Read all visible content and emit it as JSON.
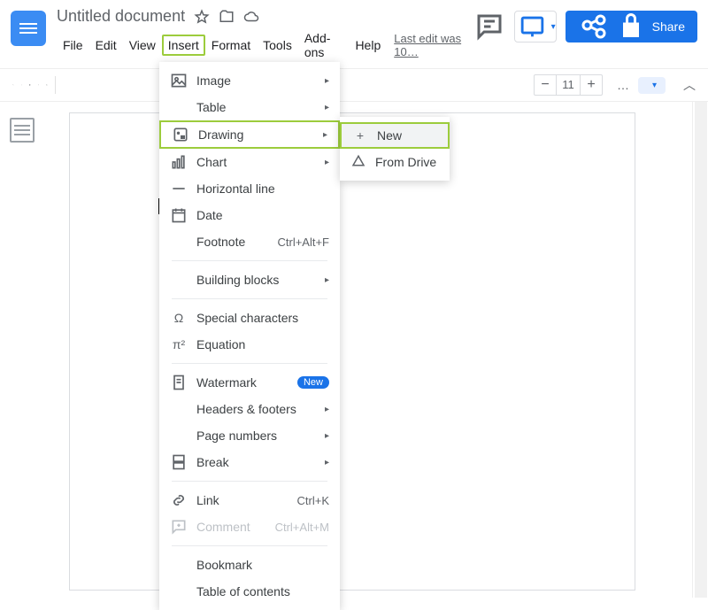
{
  "doc": {
    "title": "Untitled document"
  },
  "menu": {
    "file": "File",
    "edit": "Edit",
    "view": "View",
    "insert": "Insert",
    "format": "Format",
    "tools": "Tools",
    "addons": "Add-ons",
    "help": "Help",
    "lastedit": "Last edit was 10…"
  },
  "share": {
    "label": "Share"
  },
  "toolbar": {
    "fontsize": "11",
    "minus": "−",
    "plus": "+",
    "more": "…",
    "dropdown_caret": "▾",
    "chev_up": "︿"
  },
  "insertmenu": {
    "image": "Image",
    "table": "Table",
    "drawing": "Drawing",
    "chart": "Chart",
    "hline": "Horizontal line",
    "date": "Date",
    "footnote": "Footnote",
    "footnote_key": "Ctrl+Alt+F",
    "blocks": "Building blocks",
    "special": "Special characters",
    "equation": "Equation",
    "watermark": "Watermark",
    "new_badge": "New",
    "headers": "Headers & footers",
    "pagenum": "Page numbers",
    "break": "Break",
    "link": "Link",
    "link_key": "Ctrl+K",
    "comment": "Comment",
    "comment_key": "Ctrl+Alt+M",
    "bookmark": "Bookmark",
    "toc": "Table of contents",
    "arrow": "▸"
  },
  "drawingmenu": {
    "new": "New",
    "fromdrive": "From Drive",
    "plus": "+"
  }
}
